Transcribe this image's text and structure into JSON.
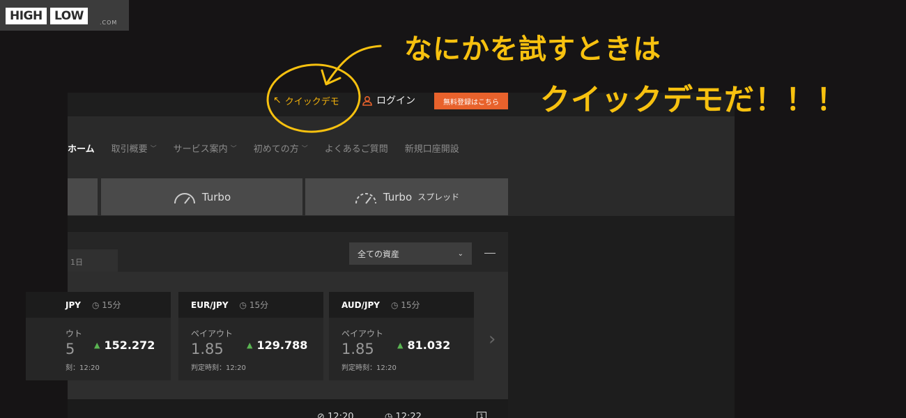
{
  "logo": {
    "high": "HIGH",
    "low": "LOW",
    "com": ".COM"
  },
  "topbar": {
    "quickdemo_label": "クイックデモ",
    "login_label": "ログイン",
    "register_label": "無料登録はこちら"
  },
  "nav": [
    {
      "label": "ホーム",
      "has_dropdown": false
    },
    {
      "label": "取引概要",
      "has_dropdown": true
    },
    {
      "label": "サービス案内",
      "has_dropdown": true
    },
    {
      "label": "初めての方",
      "has_dropdown": true
    },
    {
      "label": "よくあるご質問",
      "has_dropdown": false
    },
    {
      "label": "新規口座開設",
      "has_dropdown": false
    }
  ],
  "tabs": [
    {
      "label": "Turbo",
      "suffix": ""
    },
    {
      "label": "Turbo",
      "suffix": "スプレッド"
    }
  ],
  "panel": {
    "period_tab": "1日",
    "asset_select": "全ての資産",
    "cards": [
      {
        "pair": "JPY",
        "duration": "15分",
        "payout_label": "ウト",
        "payout": "5",
        "rate": "152.272",
        "expiry": "刻：12:20"
      },
      {
        "pair": "EUR/JPY",
        "duration": "15分",
        "payout_label": "ペイアウト",
        "payout": "1.85",
        "rate": "129.788",
        "expiry": "判定時刻：12:20"
      },
      {
        "pair": "AUD/JPY",
        "duration": "15分",
        "payout_label": "ペイアウト",
        "payout": "1.85",
        "rate": "81.032",
        "expiry": "判定時刻：12:20"
      }
    ],
    "bottom_times": [
      "12:20",
      "12:22"
    ],
    "bottom_box": "1"
  },
  "annotations": {
    "line1": "なにかを試すときは",
    "line2": "クイックデモだ！！！",
    "highlight_color": "#f7c10f"
  },
  "colors": {
    "accent_orange": "#e8622c",
    "quickdemo_yellow": "#f5b30b",
    "up_green": "#5ab552"
  }
}
